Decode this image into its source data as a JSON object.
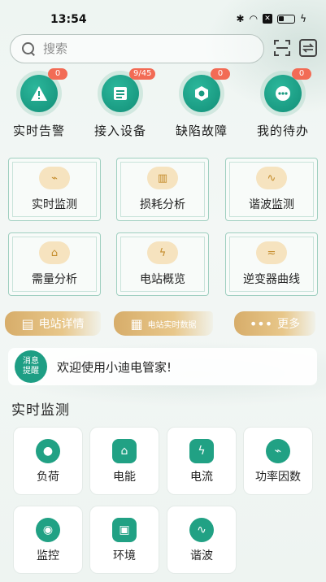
{
  "status_bar": {
    "time": "13:54"
  },
  "search": {
    "placeholder": "搜索"
  },
  "quick_actions": [
    {
      "label": "实时告警",
      "badge": "0",
      "icon": "warning-icon"
    },
    {
      "label": "接入设备",
      "badge": "9/45",
      "icon": "device-list-icon"
    },
    {
      "label": "缺陷故障",
      "badge": "0",
      "icon": "defect-gear-icon"
    },
    {
      "label": "我的待办",
      "badge": "0",
      "icon": "todo-dots-icon"
    }
  ],
  "feature_cards": [
    {
      "label": "实时监测",
      "icon": "monitor-wave-icon"
    },
    {
      "label": "损耗分析",
      "icon": "loss-analysis-icon"
    },
    {
      "label": "谐波监测",
      "icon": "harmonic-icon"
    },
    {
      "label": "需量分析",
      "icon": "demand-cart-icon"
    },
    {
      "label": "电站概览",
      "icon": "station-bolt-icon"
    },
    {
      "label": "逆变器曲线",
      "icon": "inverter-curve-icon"
    }
  ],
  "ribbons": [
    {
      "label": "电站详情",
      "icon": "clipboard-icon"
    },
    {
      "label": "电站实时数据",
      "icon": "realtime-data-icon"
    },
    {
      "label": "更多",
      "icon": "more-dots-icon"
    }
  ],
  "message": {
    "badge_line1": "消息",
    "badge_line2": "提醒",
    "text": "欢迎使用小迪电管家!"
  },
  "section": {
    "title": "实时监测"
  },
  "tiles": [
    {
      "label": "负荷",
      "icon": "bulb-icon"
    },
    {
      "label": "电能",
      "icon": "home-energy-icon"
    },
    {
      "label": "电流",
      "icon": "current-bolt-icon"
    },
    {
      "label": "功率因数",
      "icon": "power-factor-icon"
    },
    {
      "label": "监控",
      "icon": "camera-icon"
    },
    {
      "label": "环境",
      "icon": "environment-icon"
    },
    {
      "label": "谐波",
      "icon": "harmonic-wave-icon"
    }
  ],
  "colors": {
    "primary": "#1e9e84",
    "badge": "#f26b55",
    "ribbon": "#d7ad6a",
    "card_border": "#9fcfc0"
  }
}
